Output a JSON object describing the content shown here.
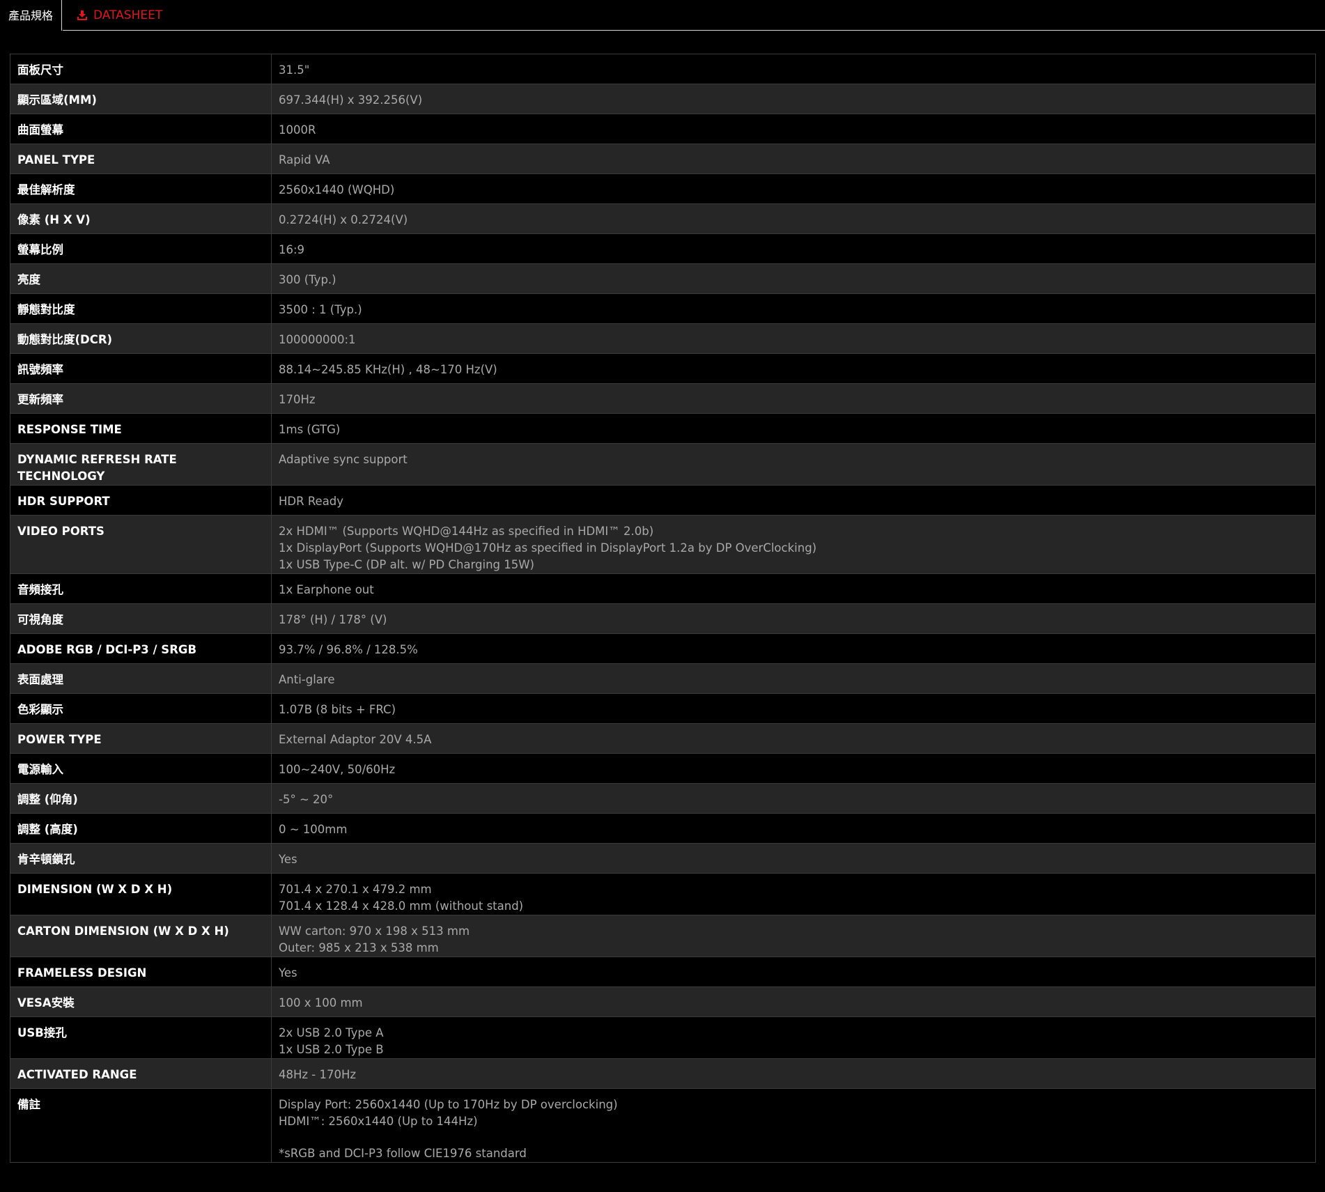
{
  "tabs": {
    "specs_label": "產品規格",
    "datasheet_label": "DATASHEET",
    "datasheet_icon": "download-icon",
    "accent_color": "#e0161c"
  },
  "specs": [
    {
      "label": "面板尺寸",
      "lines": [
        "31.5\""
      ]
    },
    {
      "label": "顯示區域(MM)",
      "lines": [
        "697.344(H) x 392.256(V)"
      ]
    },
    {
      "label": "曲面螢幕",
      "lines": [
        "1000R"
      ]
    },
    {
      "label": "PANEL TYPE",
      "lines": [
        "Rapid VA"
      ]
    },
    {
      "label": "最佳解析度",
      "lines": [
        "2560x1440 (WQHD)"
      ]
    },
    {
      "label": "像素 (H X V)",
      "lines": [
        "0.2724(H) x 0.2724(V)"
      ]
    },
    {
      "label": "螢幕比例",
      "lines": [
        "16:9"
      ]
    },
    {
      "label": "亮度",
      "lines": [
        "300 (Typ.)"
      ]
    },
    {
      "label": "靜態對比度",
      "lines": [
        "3500 : 1 (Typ.)"
      ]
    },
    {
      "label": "動態對比度(DCR)",
      "lines": [
        "100000000:1"
      ]
    },
    {
      "label": "訊號頻率",
      "lines": [
        "88.14~245.85 KHz(H) , 48~170 Hz(V)"
      ]
    },
    {
      "label": "更新頻率",
      "lines": [
        "170Hz"
      ]
    },
    {
      "label": "RESPONSE TIME",
      "lines": [
        "1ms (GTG)"
      ]
    },
    {
      "label": "DYNAMIC REFRESH RATE TECHNOLOGY",
      "lines": [
        "Adaptive sync support"
      ]
    },
    {
      "label": "HDR SUPPORT",
      "lines": [
        "HDR Ready"
      ]
    },
    {
      "label": "VIDEO PORTS",
      "lines": [
        "2x HDMI™ (Supports WQHD@144Hz as specified in HDMI™ 2.0b)",
        "1x DisplayPort (Supports WQHD@170Hz as specified in DisplayPort 1.2a by DP OverClocking)",
        "1x USB Type-C (DP alt. w/ PD Charging 15W)"
      ]
    },
    {
      "label": "音頻接孔",
      "lines": [
        "1x Earphone out"
      ]
    },
    {
      "label": "可視角度",
      "lines": [
        "178° (H) / 178° (V)"
      ]
    },
    {
      "label": "ADOBE RGB / DCI-P3 / SRGB",
      "lines": [
        "93.7% / 96.8% / 128.5%"
      ]
    },
    {
      "label": "表面處理",
      "lines": [
        "Anti-glare"
      ]
    },
    {
      "label": "色彩顯示",
      "lines": [
        "1.07B (8 bits + FRC)"
      ]
    },
    {
      "label": "POWER TYPE",
      "lines": [
        "External Adaptor 20V 4.5A"
      ]
    },
    {
      "label": "電源輸入",
      "lines": [
        "100~240V, 50/60Hz"
      ]
    },
    {
      "label": "調整 (仰角)",
      "lines": [
        "-5° ~ 20°"
      ]
    },
    {
      "label": "調整 (高度)",
      "lines": [
        "0 ~ 100mm"
      ]
    },
    {
      "label": "肯辛頓鎖孔",
      "lines": [
        "Yes"
      ]
    },
    {
      "label": "DIMENSION (W X D X H)",
      "lines": [
        "701.4 x 270.1 x 479.2 mm",
        "701.4 x 128.4 x 428.0 mm (without stand)"
      ]
    },
    {
      "label": "CARTON DIMENSION (W X D X H)",
      "lines": [
        "WW carton: 970 x 198 x 513 mm",
        "Outer: 985 x 213 x 538 mm"
      ]
    },
    {
      "label": "FRAMELESS DESIGN",
      "lines": [
        "Yes"
      ]
    },
    {
      "label": "VESA安裝",
      "lines": [
        "100 x 100 mm"
      ]
    },
    {
      "label": "USB接孔",
      "lines": [
        "2x USB 2.0 Type A",
        "1x USB 2.0 Type B"
      ]
    },
    {
      "label": "ACTIVATED RANGE",
      "lines": [
        "48Hz - 170Hz"
      ]
    },
    {
      "label": "備註",
      "lines": [
        "Display Port: 2560x1440 (Up to 170Hz by DP overclocking)",
        "HDMI™: 2560x1440 (Up to 144Hz)",
        "",
        "*sRGB and DCI-P3 follow CIE1976 standard"
      ]
    }
  ]
}
